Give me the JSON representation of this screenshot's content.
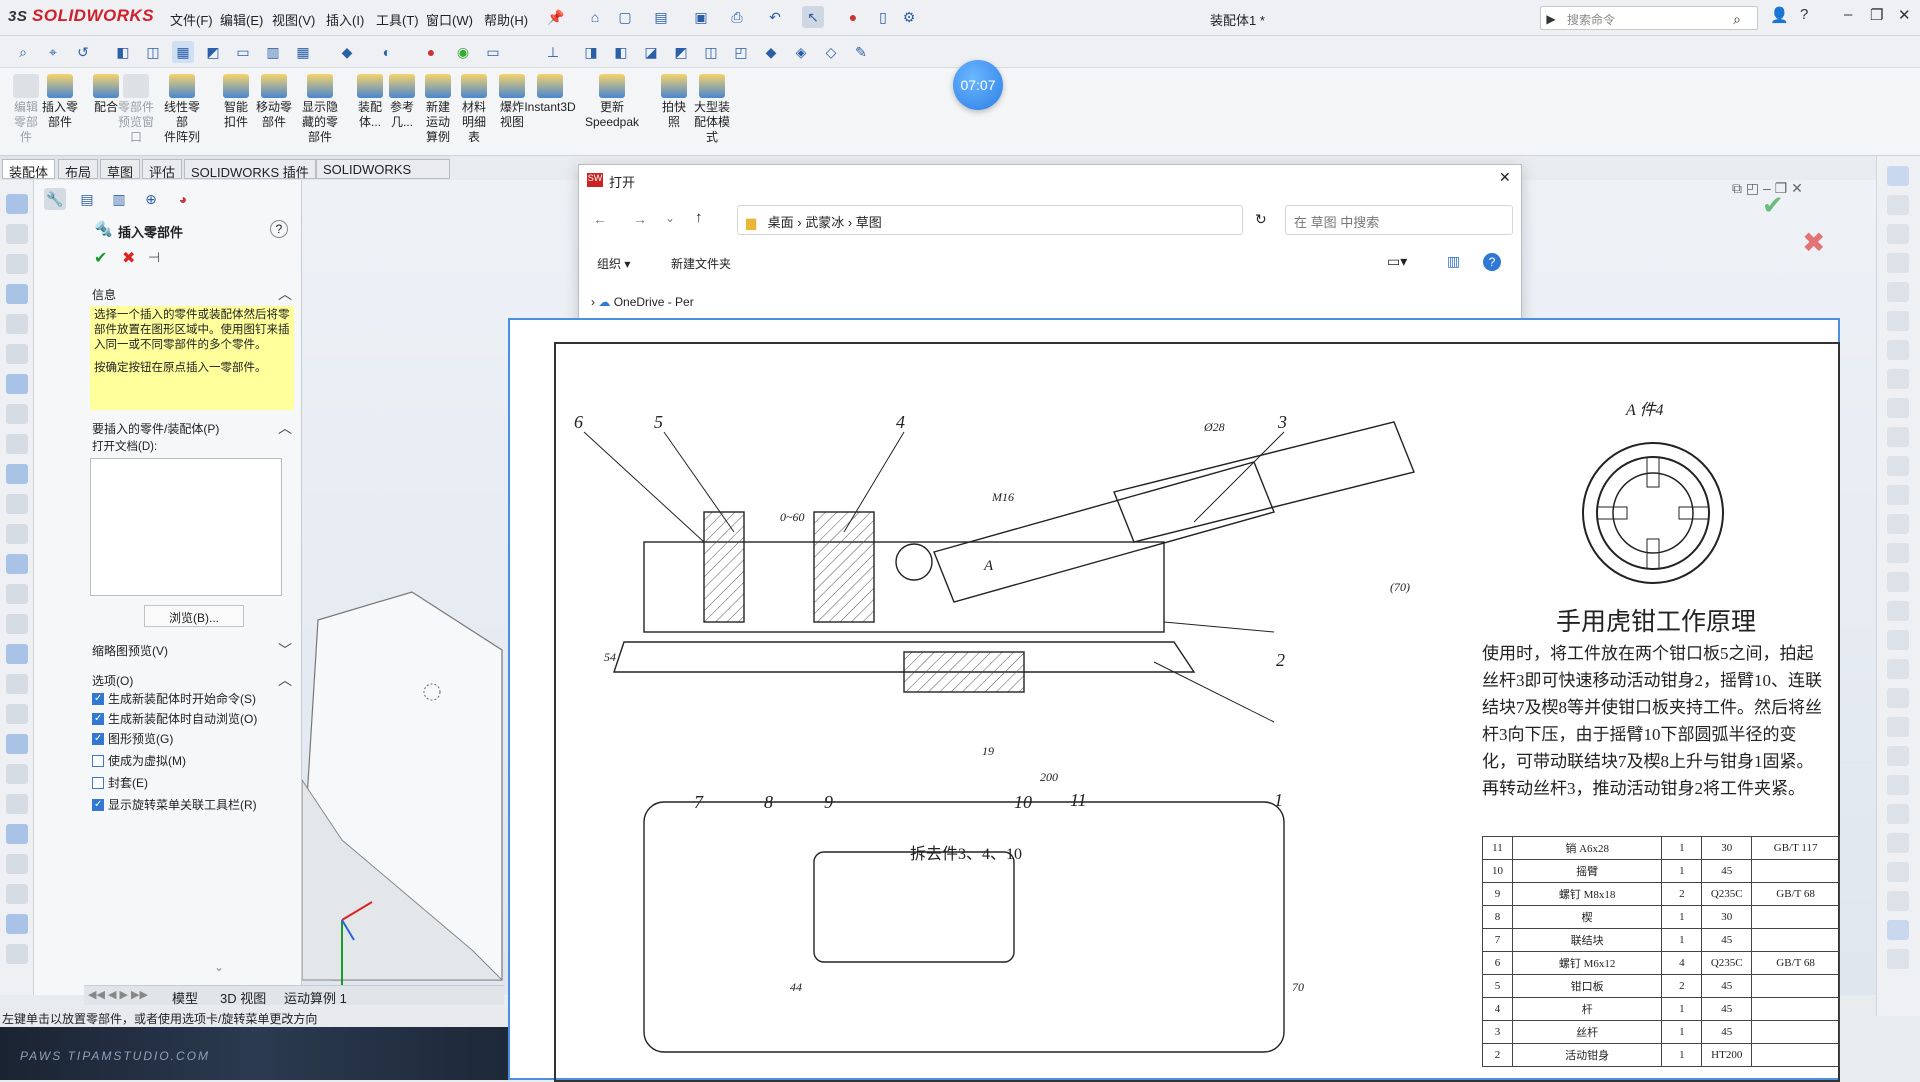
{
  "app": {
    "brand": "SOLIDWORKS",
    "doc_title": "装配体1 *"
  },
  "menu": [
    "文件(F)",
    "编辑(E)",
    "视图(V)",
    "插入(I)",
    "工具(T)",
    "窗口(W)",
    "帮助(H)"
  ],
  "search": {
    "placeholder": "搜索命令"
  },
  "timer": "07:07",
  "ribbon": [
    {
      "label": "编辑\n零部\n件",
      "dim": true
    },
    {
      "label": "插入零\n部件",
      "dim": false
    },
    {
      "label": "配合",
      "dim": false
    },
    {
      "label": "零部件\n预览窗\n口",
      "dim": true
    },
    {
      "label": "线性零部\n件阵列",
      "dim": false
    },
    {
      "label": "智能\n扣件",
      "dim": false
    },
    {
      "label": "移动零\n部件",
      "dim": false
    },
    {
      "label": "显示隐\n藏的零\n部件",
      "dim": false
    },
    {
      "label": "装配\n体...",
      "dim": false
    },
    {
      "label": "参考\n几...",
      "dim": false
    },
    {
      "label": "新建\n运动\n算例",
      "dim": false
    },
    {
      "label": "材料\n明细\n表",
      "dim": false
    },
    {
      "label": "爆炸\n视图",
      "dim": false
    },
    {
      "label": "Instant3D",
      "dim": false
    },
    {
      "label": "更新\nSpeedpak",
      "dim": false
    },
    {
      "label": "拍快\n照",
      "dim": false
    },
    {
      "label": "大型装\n配体模\n式",
      "dim": false
    }
  ],
  "tabs": [
    "装配体",
    "布局",
    "草图",
    "评估",
    "SOLIDWORKS 插件",
    "SOLIDWORKS MBD"
  ],
  "pm": {
    "title": "插入零部件",
    "info_title": "信息",
    "info_text": "选择一个插入的零件或装配体然后将零部件放置在图形区域中。使用图钉来插入同一或不同零部件的多个零件。",
    "info_text2": "按确定按钮在原点插入一零部件。",
    "part_section": "要插入的零件/装配体(P)",
    "open_docs": "打开文档(D):",
    "browse": "浏览(B)...",
    "thumb": "缩略图预览(V)",
    "options": "选项(O)",
    "checks": [
      {
        "label": "生成新装配体时开始命令(S)",
        "on": true
      },
      {
        "label": "生成新装配体时自动浏览(O)",
        "on": true
      },
      {
        "label": "图形预览(G)",
        "on": true
      },
      {
        "label": "使成为虚拟(M)",
        "on": false
      },
      {
        "label": "封套(E)",
        "on": false
      },
      {
        "label": "显示旋转菜单关联工具栏(R)",
        "on": true
      }
    ]
  },
  "bottom_tabs": [
    "模型",
    "3D 视图",
    "运动算例 1"
  ],
  "status": "左键单击以放置零部件，或者使用选项卡/旋转菜单更改方向",
  "taskbar_text": "PAWS TIPAMSTUDIO.COM",
  "dialog": {
    "title": "打开",
    "path": [
      "桌面",
      "武蒙冰",
      "草图"
    ],
    "search_placeholder": "在 草图 中搜索",
    "organize": "组织",
    "new_folder": "新建文件夹",
    "tree_item": "OneDrive - Per"
  },
  "drawing": {
    "title": "手用虎钳工作原理",
    "view_label": "A 件4",
    "section_label": "拆去件3、4、10",
    "description": "使用时，将工件放在两个钳口板5之间，拍起丝杆3即可快速移动活动钳身2，摇臂10、连联结块7及楔8等并使钳口板夹持工件。然后将丝杆3向下压，由于摇臂10下部圆弧半径的变化，可带动联结块7及楔8上升与钳身1固紧。再转动丝杆3，推动活动钳身2将工件夹紧。",
    "callouts": [
      "6",
      "5",
      "4",
      "3",
      "2",
      "1",
      "7",
      "8",
      "9",
      "10",
      "11"
    ],
    "dims": [
      "Ø28",
      "M16",
      "0~60",
      "54",
      "19",
      "200",
      "(70)",
      "A",
      "44",
      "70"
    ],
    "bom": [
      [
        "11",
        "销 A6x28",
        "1",
        "30",
        "GB/T 117"
      ],
      [
        "10",
        "摇臂",
        "1",
        "45",
        ""
      ],
      [
        "9",
        "螺钉 M8x18",
        "2",
        "Q235C",
        "GB/T 68"
      ],
      [
        "8",
        "楔",
        "1",
        "30",
        ""
      ],
      [
        "7",
        "联结块",
        "1",
        "45",
        ""
      ],
      [
        "6",
        "螺钉 M6x12",
        "4",
        "Q235C",
        "GB/T 68"
      ],
      [
        "5",
        "钳口板",
        "2",
        "45",
        ""
      ],
      [
        "4",
        "杆",
        "1",
        "45",
        ""
      ],
      [
        "3",
        "丝杆",
        "1",
        "45",
        ""
      ],
      [
        "2",
        "活动钳身",
        "1",
        "HT200",
        ""
      ]
    ]
  }
}
